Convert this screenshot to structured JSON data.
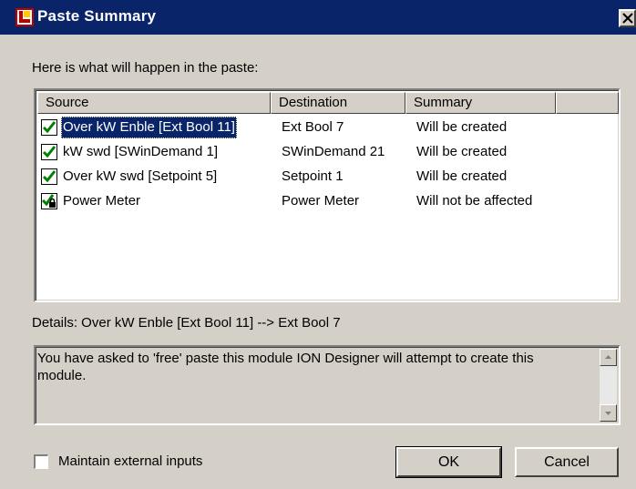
{
  "window": {
    "title": "Paste Summary"
  },
  "intro_text": "Here is what will happen in the paste:",
  "columns": [
    "Source",
    "Destination",
    "Summary"
  ],
  "rows": [
    {
      "source": "Over kW Enble [Ext Bool 11]",
      "destination": "Ext Bool 7",
      "summary": "Will be created",
      "icon": "green-check-icon"
    },
    {
      "source": "kW swd [SWinDemand 1]",
      "destination": "SWinDemand 21",
      "summary": "Will be created",
      "icon": "green-check-icon"
    },
    {
      "source": "Over kW swd [Setpoint 5]",
      "destination": "Setpoint 1",
      "summary": "Will be created",
      "icon": "green-check-icon"
    },
    {
      "source": "Power Meter",
      "destination": "Power Meter",
      "summary": "Will not be affected",
      "icon": "check-lock-icon"
    }
  ],
  "details_label": "Details: Over kW Enble [Ext Bool 11] --> Ext Bool 7",
  "details_text": "You have asked to 'free' paste this module  ION Designer will attempt to create this module.",
  "maintain_inputs_label": "Maintain external inputs",
  "maintain_inputs_checked": false,
  "buttons": {
    "ok": "OK",
    "cancel": "Cancel"
  },
  "colors": {
    "titlebar": "#0a246a",
    "selection": "#0a246a",
    "check": "#008000",
    "face": "#d4d0c8"
  }
}
